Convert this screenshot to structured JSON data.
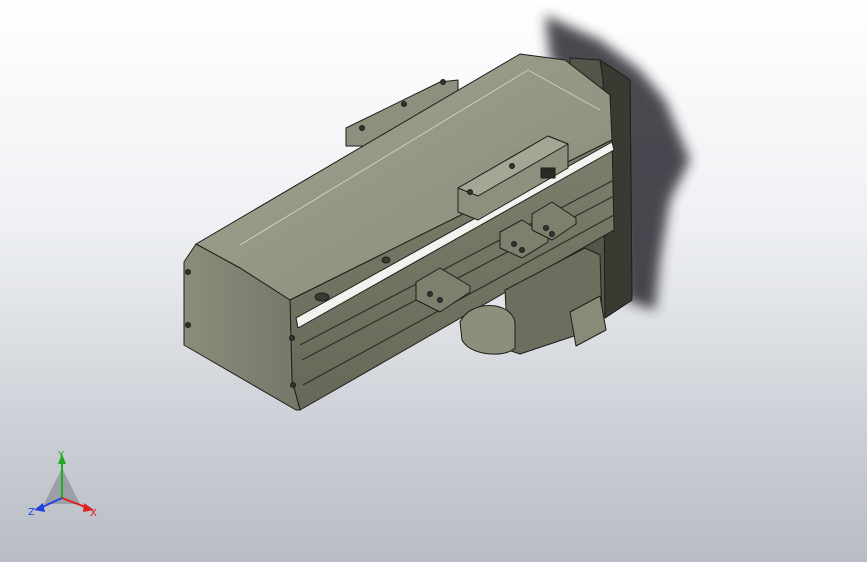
{
  "viewport": {
    "background_top": "#ffffff",
    "background_bottom": "#b8bcc4",
    "model_body_color": "#8a8a78",
    "model_edge_color": "#1e1e1a",
    "rail_color": "#f2f2ee",
    "shadow_color": "#2b2b33"
  },
  "triad": {
    "x_label": "X",
    "y_label": "Y",
    "z_label": "Z",
    "x_color": "#e02020",
    "y_color": "#22aa22",
    "z_color": "#2244dd"
  }
}
